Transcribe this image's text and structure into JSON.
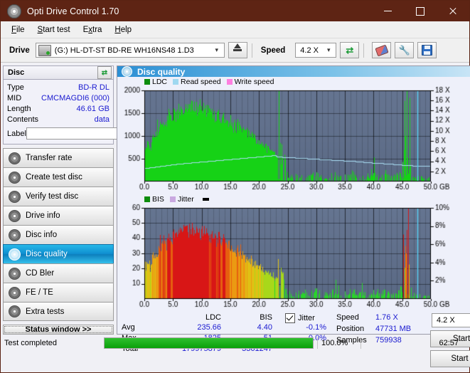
{
  "window": {
    "title": "Opti Drive Control 1.70",
    "icon": "disc-icon",
    "minimize": "minimize-icon",
    "maximize": "maximize-icon",
    "close": "close-icon"
  },
  "menu": {
    "items": [
      "File",
      "Start test",
      "Extra",
      "Help"
    ]
  },
  "toolbar": {
    "drive_label": "Drive",
    "drive_value": "(G:)  HL-DT-ST BD-RE  WH16NS48 1.D3",
    "eject_icon": "eject-icon",
    "speed_label": "Speed",
    "speed_value": "4.2 X",
    "refresh_icon": "refresh-icon",
    "eraser_icon": "eraser-icon",
    "wrench_icon": "wrench-icon",
    "save_icon": "save-icon"
  },
  "disc_panel": {
    "title": "Disc",
    "refresh_icon": "refresh-icon",
    "rows": [
      {
        "key": "Type",
        "value": "BD-R DL"
      },
      {
        "key": "MID",
        "value": "CMCMAGDI6 (000)"
      },
      {
        "key": "Length",
        "value": "46.61 GB"
      },
      {
        "key": "Contents",
        "value": "data"
      }
    ],
    "label_key": "Label",
    "label_value": "",
    "label_placeholder": "",
    "disc_icon": "cd-icon"
  },
  "nav": {
    "items": [
      {
        "label": "Transfer rate",
        "active": false
      },
      {
        "label": "Create test disc",
        "active": false
      },
      {
        "label": "Verify test disc",
        "active": false
      },
      {
        "label": "Drive info",
        "active": false
      },
      {
        "label": "Disc info",
        "active": false
      },
      {
        "label": "Disc quality",
        "active": true
      },
      {
        "label": "CD Bler",
        "active": false
      },
      {
        "label": "FE / TE",
        "active": false
      },
      {
        "label": "Extra tests",
        "active": false
      }
    ],
    "status_window": "Status window >>"
  },
  "panel": {
    "header": "Disc quality",
    "header_icon": "disc-quality-icon"
  },
  "stats": {
    "col_ldc": "LDC",
    "col_bis": "BIS",
    "rows": [
      {
        "key": "Avg",
        "ldc": "235.66",
        "bis": "4.40"
      },
      {
        "key": "Max",
        "ldc": "1825",
        "bis": "51"
      },
      {
        "key": "Total",
        "ldc": "179975879",
        "bis": "3361247"
      }
    ],
    "jitter_label": "Jitter",
    "jitter_checked": true,
    "jitter_values": [
      "-0.1%",
      "0.0%"
    ],
    "speed_label": "Speed",
    "speed_value": "1.76 X",
    "position_label": "Position",
    "position_value": "47731 MB",
    "samples_label": "Samples",
    "samples_value": "759938",
    "speed_select": "4.2 X",
    "start_full": "Start full",
    "start_part": "Start part"
  },
  "statusbar": {
    "message": "Test completed",
    "progress_text": "100.0%",
    "progress_value": 100,
    "elapsed": "62:57"
  },
  "colors": {
    "title_bar": "#5e2414",
    "accent": "#0f8fd0",
    "ldc_green": "#16d216",
    "read_speed": "#9fd8f0",
    "write_speed": "#ff7fe0",
    "bis_green": "#16d216",
    "jitter": "#c9a8e0",
    "plot_bg": "#5f6f8c",
    "value_text": "#1a1ad0",
    "progress": "#0aa00a"
  },
  "chart_data": [
    {
      "id": "ldc-chart",
      "type": "area",
      "title": "Disc quality",
      "xlabel": "GB",
      "ylabel": "LDC",
      "xlim": [
        0,
        50
      ],
      "ylim": [
        0,
        2000
      ],
      "y2lim": [
        0,
        18
      ],
      "y2label": "X",
      "xticks": [
        "0.0",
        "5.0",
        "10.0",
        "15.0",
        "20.0",
        "25.0",
        "30.0",
        "35.0",
        "40.0",
        "45.0",
        "50.0 GB"
      ],
      "yticks": [
        2000,
        1500,
        1000,
        500
      ],
      "y2ticks": [
        "18 X",
        "16 X",
        "14 X",
        "12 X",
        "10 X",
        "8 X",
        "6 X",
        "4 X",
        "2 X"
      ],
      "grid": true,
      "legend": [
        "LDC",
        "Read speed",
        "Write speed"
      ],
      "legend_position": "top-left",
      "marker_line_x": 47.7,
      "series": [
        {
          "name": "LDC",
          "color": "#16d216",
          "x": [
            0.2,
            0.6,
            1.0,
            1.4,
            1.8,
            2.2,
            2.6,
            3.0,
            3.4,
            3.8,
            4.2,
            4.6,
            5.0,
            5.4,
            5.8,
            6.2,
            6.6,
            7.0,
            7.4,
            7.8,
            8.2,
            8.6,
            9.0,
            9.4,
            9.8,
            10.2,
            10.6,
            11.0,
            11.4,
            11.8,
            12.2,
            12.6,
            13.0,
            13.4,
            13.8,
            14.2,
            14.6,
            15.0,
            15.4,
            15.8,
            16.2,
            16.6,
            17.0,
            17.4,
            17.8,
            18.2,
            18.6,
            19.0,
            19.4,
            19.8,
            20.2,
            20.6,
            21.0,
            21.4,
            21.8,
            22.2,
            22.6,
            23.0,
            23.4,
            23.8,
            24.2,
            25.0,
            26.0,
            27.0,
            28.0,
            29.0,
            30.0,
            31.0,
            32.0,
            33.0,
            34.0,
            35.0,
            36.0,
            37.0,
            38.0,
            39.0,
            40.0,
            41.0,
            42.0,
            43.0,
            44.0,
            45.0,
            45.6,
            46.0,
            46.4,
            47.0,
            47.4
          ],
          "y": [
            760,
            880,
            700,
            1020,
            980,
            1060,
            1180,
            1240,
            1320,
            1300,
            1420,
            1380,
            1460,
            1500,
            1480,
            1560,
            1600,
            1640,
            1700,
            1660,
            1620,
            1720,
            1680,
            1640,
            1600,
            1560,
            1580,
            1520,
            1540,
            1480,
            1460,
            1420,
            1440,
            1380,
            1400,
            1340,
            1300,
            1320,
            1260,
            1220,
            1240,
            1180,
            1140,
            1100,
            1120,
            1060,
            1020,
            980,
            940,
            900,
            860,
            820,
            780,
            740,
            700,
            660,
            620,
            580,
            560,
            520,
            480,
            90,
            70,
            110,
            60,
            95,
            130,
            70,
            85,
            120,
            65,
            90,
            150,
            70,
            100,
            60,
            110,
            80,
            140,
            70,
            95,
            160,
            600,
            980,
            120,
            80,
            60
          ]
        },
        {
          "name": "Read speed",
          "color": "#9fd8f0",
          "units": "X",
          "x": [
            0,
            2,
            4,
            6,
            8,
            10,
            12,
            14,
            16,
            18,
            20,
            22,
            23,
            23.2,
            25,
            28,
            31,
            34,
            37,
            40,
            43,
            45,
            46.5,
            47.5,
            48
          ],
          "y": [
            2.6,
            2.9,
            3.2,
            3.5,
            3.7,
            3.9,
            4.1,
            4.3,
            4.5,
            4.7,
            4.9,
            5.1,
            5.2,
            4.9,
            4.8,
            4.6,
            4.4,
            4.2,
            4.0,
            3.7,
            3.5,
            3.3,
            3.2,
            3.1,
            3.1
          ]
        },
        {
          "name": "Write speed",
          "color": "#ff7fe0",
          "x": [],
          "y": []
        }
      ]
    },
    {
      "id": "bis-chart",
      "type": "area",
      "xlabel": "GB",
      "ylabel": "BIS",
      "xlim": [
        0,
        50
      ],
      "ylim": [
        0,
        60
      ],
      "y2lim": [
        0,
        10
      ],
      "y2label": "%",
      "xticks": [
        "0.0",
        "5.0",
        "10.0",
        "15.0",
        "20.0",
        "25.0",
        "30.0",
        "35.0",
        "40.0",
        "45.0",
        "50.0 GB"
      ],
      "yticks": [
        60,
        50,
        40,
        30,
        20,
        10
      ],
      "y2ticks": [
        "10%",
        "8%",
        "6%",
        "4%",
        "2%"
      ],
      "grid": true,
      "legend": [
        "BIS",
        "Jitter"
      ],
      "legend_position": "top-left",
      "marker_line_x": 47.7,
      "series": [
        {
          "name": "BIS",
          "color_scale": [
            "#16d216",
            "#d2d216",
            "#e88c16",
            "#d21616"
          ],
          "x": [
            0.2,
            0.6,
            1.0,
            1.4,
            1.8,
            2.2,
            2.6,
            3.0,
            3.4,
            3.8,
            4.2,
            4.6,
            5.0,
            5.4,
            5.8,
            6.2,
            6.6,
            7.0,
            7.4,
            7.8,
            8.2,
            8.6,
            9.0,
            9.4,
            9.8,
            10.2,
            10.6,
            11.0,
            11.4,
            11.8,
            12.2,
            12.6,
            13.0,
            13.4,
            13.8,
            14.2,
            14.6,
            15.0,
            15.4,
            15.8,
            16.2,
            16.6,
            17.0,
            17.4,
            17.8,
            18.2,
            18.6,
            19.0,
            19.4,
            19.8,
            20.2,
            20.6,
            21.0,
            21.4,
            21.8,
            22.2,
            22.6,
            23.0,
            23.4,
            23.8,
            24.2,
            25.0,
            26.0,
            27.0,
            28.0,
            29.0,
            30.0,
            31.0,
            32.0,
            33.0,
            34.0,
            35.0,
            36.0,
            37.0,
            38.0,
            39.0,
            40.0,
            41.0,
            42.0,
            43.0,
            44.0,
            45.0,
            45.6,
            46.0,
            46.4,
            47.0,
            47.4
          ],
          "y": [
            22,
            26,
            20,
            29,
            28,
            31,
            34,
            33,
            38,
            36,
            40,
            39,
            42,
            44,
            43,
            46,
            45,
            48,
            47,
            44,
            46,
            43,
            45,
            42,
            44,
            41,
            43,
            40,
            42,
            39,
            41,
            38,
            40,
            37,
            39,
            36,
            34,
            35,
            33,
            31,
            32,
            30,
            29,
            28,
            27,
            26,
            25,
            24,
            23,
            22,
            21,
            20,
            19,
            18,
            17,
            16,
            15,
            14,
            13,
            12,
            11,
            3,
            2,
            4,
            2,
            3,
            4,
            2,
            3,
            4,
            2,
            3,
            5,
            2,
            3,
            2,
            4,
            3,
            5,
            2,
            3,
            5,
            7,
            9,
            3,
            2,
            2
          ]
        },
        {
          "name": "Jitter",
          "color": "#c9a8e0",
          "x": [],
          "y": []
        }
      ]
    }
  ]
}
